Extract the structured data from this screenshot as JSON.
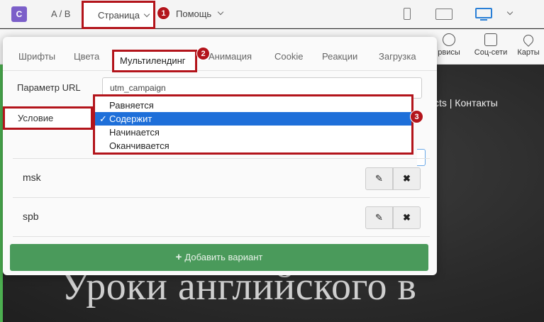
{
  "app": {
    "logo_letter": "C",
    "ab_label": "A / B",
    "accent_color": "#b3141b",
    "primary_color": "#1e6fd9"
  },
  "topbar": {
    "page_menu_label": "Страница",
    "help_menu_label": "Помощь"
  },
  "badges": [
    "1",
    "2",
    "3"
  ],
  "toolbar2": {
    "services_label": "рвисы",
    "social_label": "Соц-сети",
    "maps_label": "Карты"
  },
  "tabs": [
    {
      "label": "Шрифты"
    },
    {
      "label": "Цвета"
    },
    {
      "label": "Мультилендинг",
      "active": true
    },
    {
      "label": "Анимация"
    },
    {
      "label": "Cookie"
    },
    {
      "label": "Реакции"
    },
    {
      "label": "Загрузка"
    }
  ],
  "form": {
    "url_param_label": "Параметр URL",
    "url_param_value": "utm_campaign",
    "condition_label": "Условие"
  },
  "dropdown": {
    "options": [
      {
        "label": "Равняется",
        "selected": false
      },
      {
        "label": "Содержит",
        "selected": true
      },
      {
        "label": "Начинается",
        "selected": false
      },
      {
        "label": "Оканчивается",
        "selected": false
      }
    ]
  },
  "variants": [
    {
      "name": "msk"
    },
    {
      "name": "spb"
    }
  ],
  "add_button_label": "Добавить вариант",
  "background_site": {
    "nav_text": "cts | Контакты",
    "heading": "Уроки английского в"
  }
}
